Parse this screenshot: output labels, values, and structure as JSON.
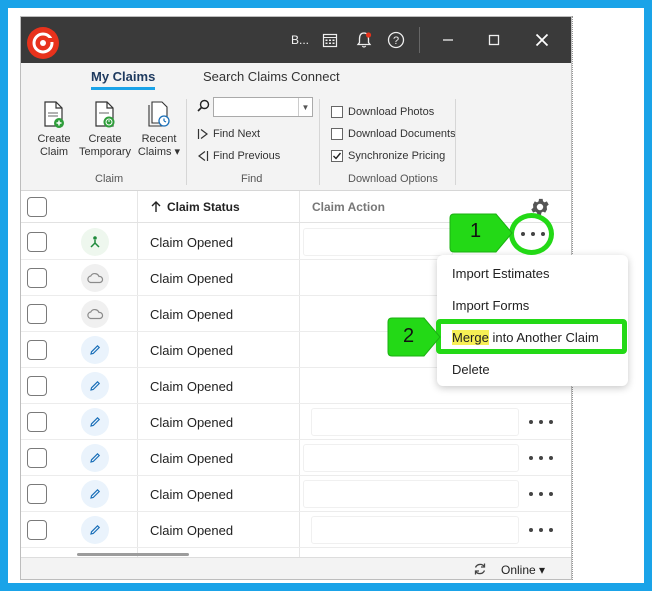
{
  "titlebar": {
    "user_initial": "B..."
  },
  "ribbon": {
    "tabs": [
      {
        "label": "My Claims",
        "active": true
      },
      {
        "label": "Search Claims Connect",
        "active": false
      }
    ],
    "claim_group": {
      "label": "Claim",
      "buttons": [
        {
          "line1": "Create",
          "line2": "Claim"
        },
        {
          "line1": "Create",
          "line2": "Temporary"
        },
        {
          "line1": "Recent",
          "line2": "Claims ▾"
        }
      ]
    },
    "find_group": {
      "label": "Find",
      "input_value": "",
      "find_next": "Find Next",
      "find_previous": "Find Previous"
    },
    "download_group": {
      "label": "Download Options",
      "options": [
        {
          "label": "Download Photos",
          "checked": false
        },
        {
          "label": "Download Documents",
          "checked": false
        },
        {
          "label": "Synchronize Pricing",
          "checked": true
        }
      ]
    }
  },
  "grid": {
    "headers": {
      "claim_status": "Claim Status",
      "claim_action": "Claim Action"
    },
    "rows": [
      {
        "icon": "person-branch-icon",
        "status": "Claim Opened"
      },
      {
        "icon": "cloud-icon",
        "status": "Claim Opened"
      },
      {
        "icon": "cloud-icon",
        "status": "Claim Opened"
      },
      {
        "icon": "pencil-icon",
        "status": "Claim Opened"
      },
      {
        "icon": "pencil-icon",
        "status": "Claim Opened"
      },
      {
        "icon": "pencil-icon",
        "status": "Claim Opened"
      },
      {
        "icon": "pencil-icon",
        "status": "Claim Opened"
      },
      {
        "icon": "pencil-icon",
        "status": "Claim Opened"
      },
      {
        "icon": "pencil-icon",
        "status": "Claim Opened"
      }
    ]
  },
  "menu": {
    "items": [
      {
        "label": "Import Estimates"
      },
      {
        "label": "Import Forms"
      },
      {
        "label_highlight": "Merge",
        "label_rest": " into Another Claim"
      },
      {
        "label": "Delete"
      }
    ]
  },
  "statusbar": {
    "connection": "Online ▾"
  },
  "annotations": {
    "step1": "1",
    "step2": "2",
    "color": "#23d916"
  }
}
